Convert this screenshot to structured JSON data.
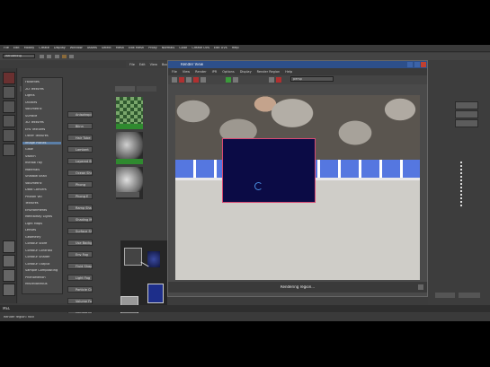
{
  "app": {
    "menubar": [
      "File",
      "Edit",
      "Modify",
      "Create",
      "Display",
      "Window",
      "Assets",
      "Select",
      "Mesh",
      "Edit Mesh",
      "Proxy",
      "Normals",
      "Color",
      "Create UVs",
      "Edit UVs",
      "Help"
    ],
    "mode": "Rendering",
    "shelf_tabs": [
      "File",
      "Edit",
      "View",
      "Bookmarks",
      "Create",
      "Tabs",
      "Graph",
      "Window",
      "Options"
    ],
    "tree_items": [
      "Favorites",
      "2D Textures",
      "Lights",
      "Utilities",
      "Volumetric",
      "Surface",
      "3D Textures",
      "Env Textures",
      "Other Textures",
      "Image Planes",
      "Glow",
      "Switch",
      "mental ray",
      "Materials",
      "Shadow Shad",
      "Volumetric",
      "Data Convers",
      "Photon Vol",
      "Textures",
      "Environments",
      "MentalRay Lights",
      "Light Maps",
      "Lenses",
      "Geometry",
      "Contour Store",
      "Contour Contrast",
      "Contour Shader",
      "Contour Output",
      "Sample Compositing",
      "PhenoMenon",
      "Miscellaneous"
    ],
    "node_buttons": [
      "Anisotropic",
      "Blinn",
      "Hair Tube Shader",
      "Lambert",
      "Layered Shader",
      "Ocean Shader",
      "Phong",
      "Phong E",
      "Ramp Shader",
      "Shading Map",
      "Surface Shader",
      "Use Background",
      "Env Fog",
      "Fluid Shape",
      "Light Fog",
      "Particle Cloud",
      "Volume Fog",
      "Volume Shader"
    ],
    "helpline": "Render region: rock",
    "cmd_label": "MEL"
  },
  "render_view": {
    "title": "Render View",
    "menu": [
      "File",
      "View",
      "Render",
      "IPR",
      "Options",
      "Display",
      "Render Region",
      "Help"
    ],
    "camera": "persp",
    "status": "Rendering region...",
    "spinner_icon": "loading-spinner-icon",
    "colors": {
      "title_bar": "#2d4f8a",
      "region_fill": "#0b0b45",
      "region_border": "#d84a72",
      "tile_blue": "#5577e0"
    }
  }
}
